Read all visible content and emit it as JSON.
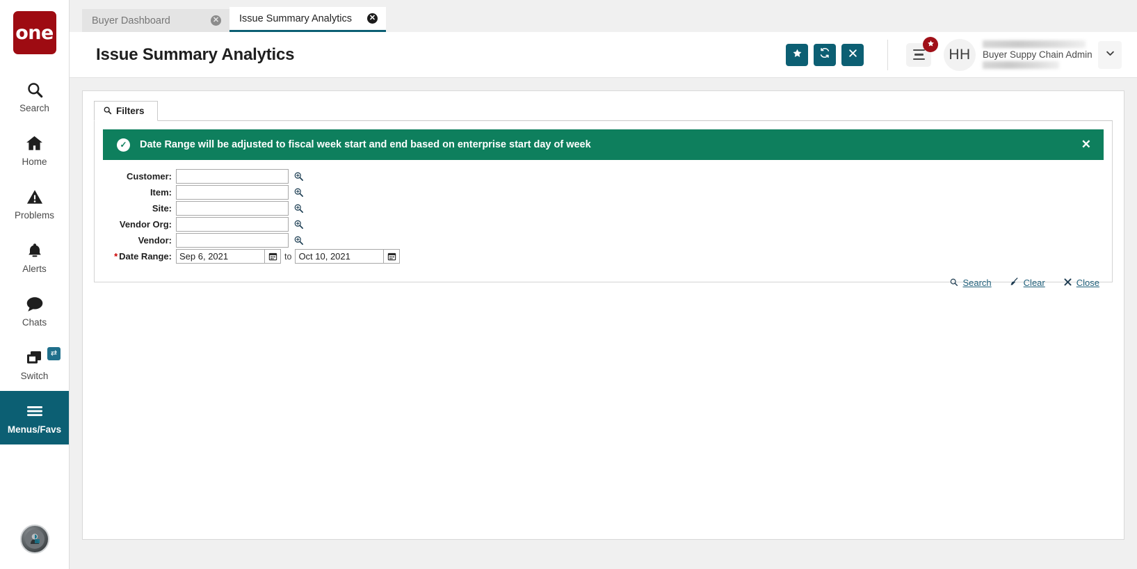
{
  "brand": {
    "logo_text": "one",
    "logo_color": "#9e0b12",
    "accent_teal": "#0c5f73",
    "banner_green": "#0e7f5d",
    "badge_red": "#a01018"
  },
  "sidebar": {
    "items": [
      {
        "label": "Search",
        "icon": "search-icon"
      },
      {
        "label": "Home",
        "icon": "home-icon"
      },
      {
        "label": "Problems",
        "icon": "warning-triangle-icon"
      },
      {
        "label": "Alerts",
        "icon": "bell-icon"
      },
      {
        "label": "Chats",
        "icon": "chat-bubble-icon"
      },
      {
        "label": "Switch",
        "icon": "switch-windows-icon",
        "badge_icon": "swap-arrows-icon"
      },
      {
        "label": "Menus/Favs",
        "icon": "hamburger-icon",
        "active": true
      }
    ],
    "bottom_avatar": "assistant-bot-avatar"
  },
  "tabs": [
    {
      "label": "Buyer Dashboard",
      "active": false,
      "close_icon": "close-circle-icon"
    },
    {
      "label": "Issue Summary Analytics",
      "active": true,
      "close_icon": "close-circle-icon"
    }
  ],
  "header": {
    "title": "Issue Summary Analytics",
    "buttons": [
      {
        "name": "favorite-button",
        "icon": "star-icon",
        "glyph": "★"
      },
      {
        "name": "refresh-button",
        "icon": "refresh-icon",
        "glyph": "↻"
      },
      {
        "name": "close-page-button",
        "icon": "close-icon",
        "glyph": "✕"
      }
    ],
    "menu_icon": "hamburger-icon",
    "menu_badge_icon": "star-icon",
    "avatar_initials": "HH",
    "user_role": "Buyer Suppy Chain Admin",
    "dropdown_icon": "chevron-down-icon"
  },
  "panel": {
    "tab_label": "Filters",
    "tab_icon": "search-icon",
    "banner": {
      "icon": "check-circle-icon",
      "message": "Date Range will be adjusted to fiscal week start and end based on enterprise start day of week",
      "close_icon": "close-icon"
    },
    "fields": [
      {
        "label": "Customer:",
        "value": "",
        "placeholder": "",
        "lookup_icon": "magnifier-plus-icon",
        "required": false
      },
      {
        "label": "Item:",
        "value": "",
        "placeholder": "",
        "lookup_icon": "magnifier-plus-icon",
        "required": false
      },
      {
        "label": "Site:",
        "value": "",
        "placeholder": "",
        "lookup_icon": "magnifier-plus-icon",
        "required": false
      },
      {
        "label": "Vendor Org:",
        "value": "",
        "placeholder": "",
        "lookup_icon": "magnifier-plus-icon",
        "required": false
      },
      {
        "label": "Vendor:",
        "value": "",
        "placeholder": "",
        "lookup_icon": "magnifier-plus-icon",
        "required": false
      }
    ],
    "date_range": {
      "label": "Date Range:",
      "required_marker": "*",
      "from_value": "Sep 6, 2021",
      "separator": "to",
      "to_value": "Oct 10, 2021",
      "calendar_icon": "calendar-icon"
    },
    "actions": [
      {
        "label": "Search",
        "icon": "search-icon"
      },
      {
        "label": "Clear",
        "icon": "broom-icon"
      },
      {
        "label": "Close",
        "icon": "close-x-icon"
      }
    ]
  }
}
